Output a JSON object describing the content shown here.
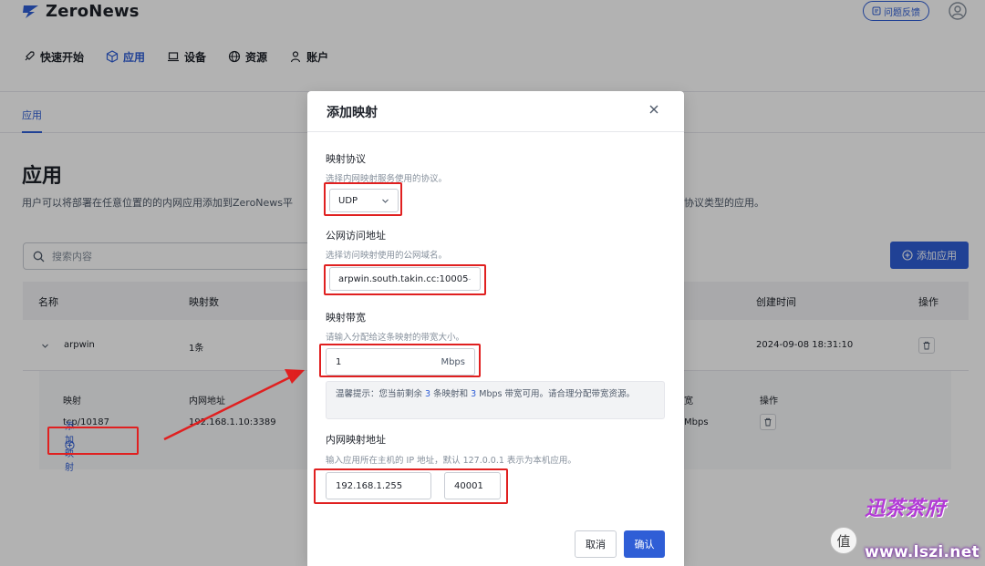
{
  "header": {
    "brand": "ZeroNews",
    "feedback_label": "问题反馈",
    "nav": [
      {
        "label": "快速开始",
        "icon": "rocket-icon"
      },
      {
        "label": "应用",
        "icon": "cube-icon"
      },
      {
        "label": "设备",
        "icon": "laptop-icon"
      },
      {
        "label": "资源",
        "icon": "globe-icon"
      },
      {
        "label": "账户",
        "icon": "user-icon"
      }
    ],
    "active_nav": "应用"
  },
  "page": {
    "subtab": "应用",
    "title": "应用",
    "description": "用户可以将部署在任意位置的的内网应用添加到ZeroNews平",
    "description_tail": "协议类型的应用。",
    "search_placeholder": "搜索内容",
    "add_app_label": "添加应用",
    "table": {
      "columns": [
        "名称",
        "映射数",
        "创建时间",
        "操作"
      ],
      "row": {
        "name": "arpwin",
        "mappings": "1条",
        "created": "2024-09-08 18:31:10"
      },
      "detail": {
        "col_mapping": "映射",
        "col_internal": "内网地址",
        "col_bandwidth_tail": "宽",
        "col_action": "操作",
        "mapping": "tcp/10187",
        "internal": "192.168.1.10:3389",
        "bandwidth_tail": "Mbps",
        "add_mapping_label": "添加映射"
      }
    }
  },
  "modal": {
    "title": "添加映射",
    "protocol": {
      "label": "映射协议",
      "hint": "选择内网映射服务使用的协议。",
      "value": "UDP"
    },
    "domain": {
      "label": "公网访问地址",
      "hint": "选择访问映射使用的公网域名。",
      "value": "arpwin.south.takin.cc:10005"
    },
    "bandwidth": {
      "label": "映射带宽",
      "hint": "请输入分配给这条映射的带宽大小。",
      "value": "1",
      "unit": "Mbps"
    },
    "tip": {
      "prefix": "温馨提示：您当前剩余",
      "count": "3",
      "mid": "条映射和",
      "bw": "3",
      "suffix": "Mbps 带宽可用。请合理分配带宽资源。"
    },
    "internal": {
      "label": "内网映射地址",
      "hint": "输入应用所在主机的 IP 地址，默认 127.0.0.1 表示为本机应用。",
      "ip": "192.168.1.255",
      "port": "40001"
    },
    "cancel_label": "取消",
    "ok_label": "确认"
  },
  "watermark": {
    "url": "www.lszi.net",
    "seal": "值",
    "logo": "迅茶茶府"
  },
  "colors": {
    "accent": "#2f5ed6",
    "highlight": "#e02020"
  }
}
